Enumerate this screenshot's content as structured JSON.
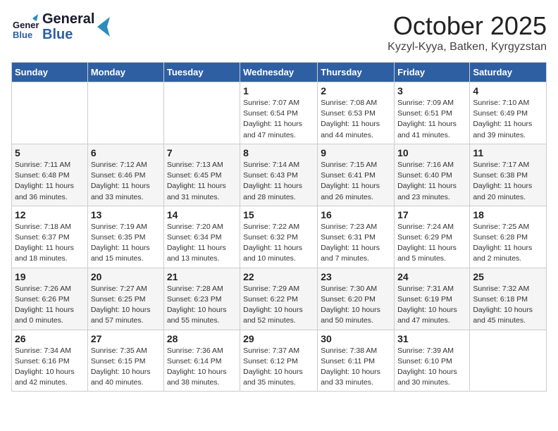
{
  "header": {
    "logo_general": "General",
    "logo_blue": "Blue",
    "month": "October 2025",
    "location": "Kyzyl-Kyya, Batken, Kyrgyzstan"
  },
  "weekdays": [
    "Sunday",
    "Monday",
    "Tuesday",
    "Wednesday",
    "Thursday",
    "Friday",
    "Saturday"
  ],
  "weeks": [
    [
      {
        "day": "",
        "info": ""
      },
      {
        "day": "",
        "info": ""
      },
      {
        "day": "",
        "info": ""
      },
      {
        "day": "1",
        "info": "Sunrise: 7:07 AM\nSunset: 6:54 PM\nDaylight: 11 hours and 47 minutes."
      },
      {
        "day": "2",
        "info": "Sunrise: 7:08 AM\nSunset: 6:53 PM\nDaylight: 11 hours and 44 minutes."
      },
      {
        "day": "3",
        "info": "Sunrise: 7:09 AM\nSunset: 6:51 PM\nDaylight: 11 hours and 41 minutes."
      },
      {
        "day": "4",
        "info": "Sunrise: 7:10 AM\nSunset: 6:49 PM\nDaylight: 11 hours and 39 minutes."
      }
    ],
    [
      {
        "day": "5",
        "info": "Sunrise: 7:11 AM\nSunset: 6:48 PM\nDaylight: 11 hours and 36 minutes."
      },
      {
        "day": "6",
        "info": "Sunrise: 7:12 AM\nSunset: 6:46 PM\nDaylight: 11 hours and 33 minutes."
      },
      {
        "day": "7",
        "info": "Sunrise: 7:13 AM\nSunset: 6:45 PM\nDaylight: 11 hours and 31 minutes."
      },
      {
        "day": "8",
        "info": "Sunrise: 7:14 AM\nSunset: 6:43 PM\nDaylight: 11 hours and 28 minutes."
      },
      {
        "day": "9",
        "info": "Sunrise: 7:15 AM\nSunset: 6:41 PM\nDaylight: 11 hours and 26 minutes."
      },
      {
        "day": "10",
        "info": "Sunrise: 7:16 AM\nSunset: 6:40 PM\nDaylight: 11 hours and 23 minutes."
      },
      {
        "day": "11",
        "info": "Sunrise: 7:17 AM\nSunset: 6:38 PM\nDaylight: 11 hours and 20 minutes."
      }
    ],
    [
      {
        "day": "12",
        "info": "Sunrise: 7:18 AM\nSunset: 6:37 PM\nDaylight: 11 hours and 18 minutes."
      },
      {
        "day": "13",
        "info": "Sunrise: 7:19 AM\nSunset: 6:35 PM\nDaylight: 11 hours and 15 minutes."
      },
      {
        "day": "14",
        "info": "Sunrise: 7:20 AM\nSunset: 6:34 PM\nDaylight: 11 hours and 13 minutes."
      },
      {
        "day": "15",
        "info": "Sunrise: 7:22 AM\nSunset: 6:32 PM\nDaylight: 11 hours and 10 minutes."
      },
      {
        "day": "16",
        "info": "Sunrise: 7:23 AM\nSunset: 6:31 PM\nDaylight: 11 hours and 7 minutes."
      },
      {
        "day": "17",
        "info": "Sunrise: 7:24 AM\nSunset: 6:29 PM\nDaylight: 11 hours and 5 minutes."
      },
      {
        "day": "18",
        "info": "Sunrise: 7:25 AM\nSunset: 6:28 PM\nDaylight: 11 hours and 2 minutes."
      }
    ],
    [
      {
        "day": "19",
        "info": "Sunrise: 7:26 AM\nSunset: 6:26 PM\nDaylight: 11 hours and 0 minutes."
      },
      {
        "day": "20",
        "info": "Sunrise: 7:27 AM\nSunset: 6:25 PM\nDaylight: 10 hours and 57 minutes."
      },
      {
        "day": "21",
        "info": "Sunrise: 7:28 AM\nSunset: 6:23 PM\nDaylight: 10 hours and 55 minutes."
      },
      {
        "day": "22",
        "info": "Sunrise: 7:29 AM\nSunset: 6:22 PM\nDaylight: 10 hours and 52 minutes."
      },
      {
        "day": "23",
        "info": "Sunrise: 7:30 AM\nSunset: 6:20 PM\nDaylight: 10 hours and 50 minutes."
      },
      {
        "day": "24",
        "info": "Sunrise: 7:31 AM\nSunset: 6:19 PM\nDaylight: 10 hours and 47 minutes."
      },
      {
        "day": "25",
        "info": "Sunrise: 7:32 AM\nSunset: 6:18 PM\nDaylight: 10 hours and 45 minutes."
      }
    ],
    [
      {
        "day": "26",
        "info": "Sunrise: 7:34 AM\nSunset: 6:16 PM\nDaylight: 10 hours and 42 minutes."
      },
      {
        "day": "27",
        "info": "Sunrise: 7:35 AM\nSunset: 6:15 PM\nDaylight: 10 hours and 40 minutes."
      },
      {
        "day": "28",
        "info": "Sunrise: 7:36 AM\nSunset: 6:14 PM\nDaylight: 10 hours and 38 minutes."
      },
      {
        "day": "29",
        "info": "Sunrise: 7:37 AM\nSunset: 6:12 PM\nDaylight: 10 hours and 35 minutes."
      },
      {
        "day": "30",
        "info": "Sunrise: 7:38 AM\nSunset: 6:11 PM\nDaylight: 10 hours and 33 minutes."
      },
      {
        "day": "31",
        "info": "Sunrise: 7:39 AM\nSunset: 6:10 PM\nDaylight: 10 hours and 30 minutes."
      },
      {
        "day": "",
        "info": ""
      }
    ]
  ]
}
